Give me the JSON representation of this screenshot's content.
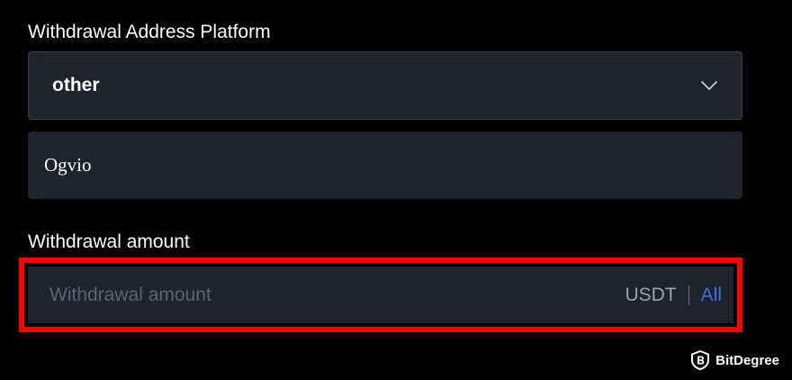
{
  "form": {
    "platform_label": "Withdrawal Address Platform",
    "platform_selected": "other",
    "platform_custom_value": "Ogvio",
    "amount_label": "Withdrawal amount",
    "amount_placeholder": "Withdrawal amount",
    "amount_unit": "USDT",
    "all_label": "All"
  },
  "colors": {
    "background": "#000000",
    "field_bg": "#1f232b",
    "highlight": "#ff0000",
    "accent": "#3d6fea"
  },
  "icons": {
    "dropdown": "chevron-down-icon",
    "watermark_logo": "bitdegree-logo-icon"
  },
  "watermark": {
    "text": "BitDegree"
  }
}
